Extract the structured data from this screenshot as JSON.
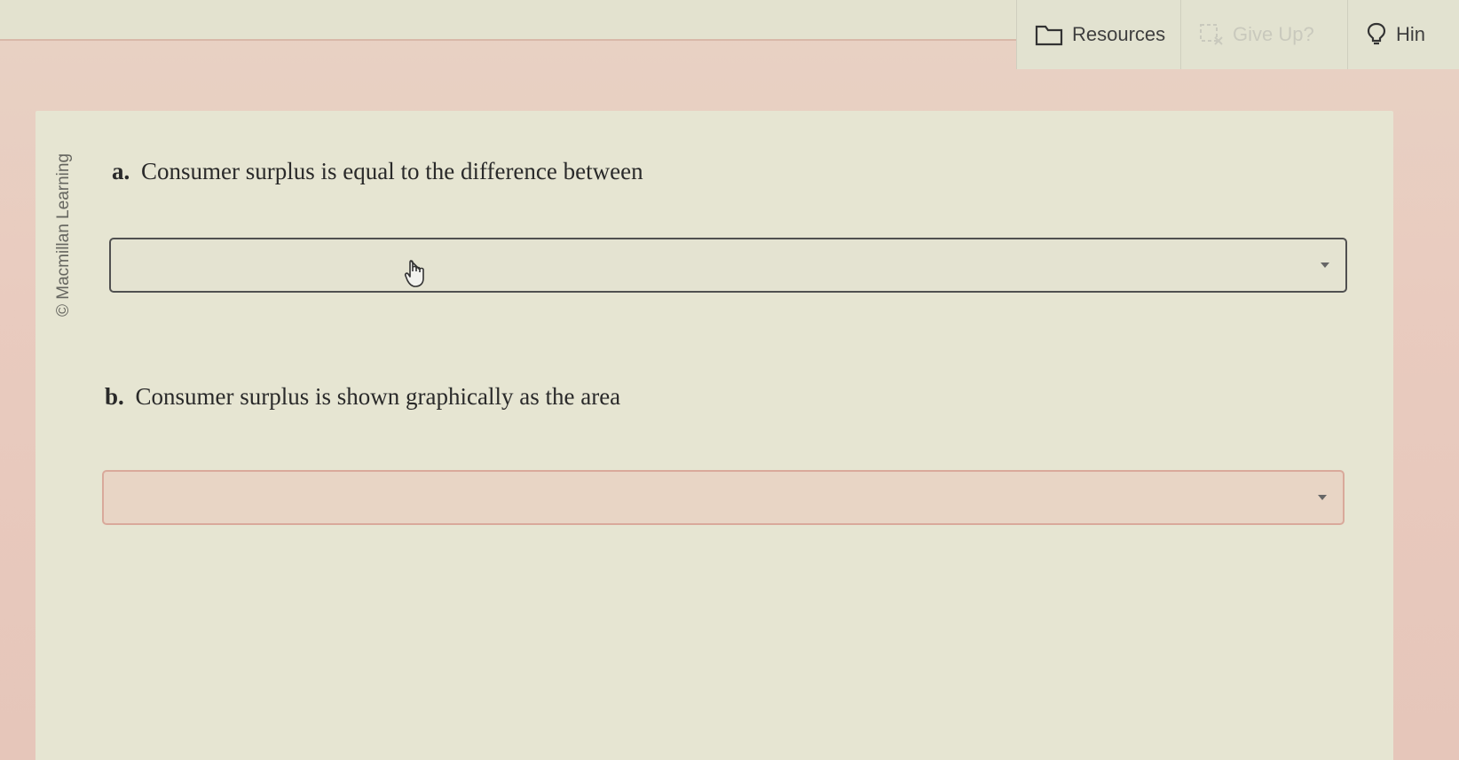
{
  "toolbar": {
    "resources_label": "Resources",
    "giveup_label": "Give Up?",
    "hint_label": "Hin"
  },
  "copyright": "© Macmillan Learning",
  "questions": [
    {
      "letter": "a.",
      "text": "Consumer surplus is equal to the difference between",
      "selected": ""
    },
    {
      "letter": "b.",
      "text": "Consumer surplus is shown graphically as the area",
      "selected": ""
    }
  ],
  "icons": {
    "resources": "folder-icon",
    "giveup": "give-up-icon",
    "hint": "lightbulb-icon",
    "dropdown": "chevron-down-icon",
    "cursor": "hand-pointer-icon"
  },
  "colors": {
    "background": "#e6e5d2",
    "active_border": "#505050",
    "inactive_border": "#d9a99b"
  }
}
